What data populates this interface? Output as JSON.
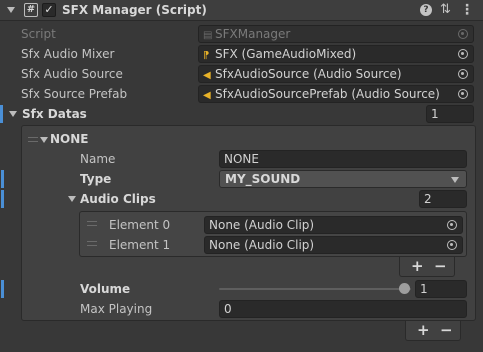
{
  "header": {
    "title": "SFX Manager (Script)",
    "enabled": true,
    "icons": [
      "hash-script-icon",
      "checkbox-icon",
      "help-icon",
      "settings-icon",
      "more-icon"
    ]
  },
  "fields": {
    "script": {
      "label": "Script",
      "value": "SFXManager"
    },
    "mixer": {
      "label": "Sfx Audio Mixer",
      "value": "SFX (GameAudioMixed)"
    },
    "source": {
      "label": "Sfx Audio Source",
      "value": "SfxAudioSource (Audio Source)"
    },
    "prefab": {
      "label": "Sfx Source Prefab",
      "value": "SfxAudioSourcePrefab (Audio Source)"
    }
  },
  "sfx_datas": {
    "label": "Sfx Datas",
    "size": "1",
    "element": {
      "title": "NONE",
      "name": {
        "label": "Name",
        "value": "NONE"
      },
      "type": {
        "label": "Type",
        "value": "MY_SOUND"
      },
      "audio_clips": {
        "label": "Audio Clips",
        "size": "2",
        "items": [
          {
            "label": "Element 0",
            "value": "None (Audio Clip)"
          },
          {
            "label": "Element 1",
            "value": "None (Audio Clip)"
          }
        ]
      },
      "volume": {
        "label": "Volume",
        "value": "1",
        "fraction": 1.0
      },
      "max_playing": {
        "label": "Max Playing",
        "value": "0"
      }
    }
  },
  "controls": {
    "plus": "+",
    "minus": "−"
  },
  "colors": {
    "accent": "#4a8fd6",
    "background": "#383838",
    "field": "#2a2a2a",
    "folder_icon": "#e8b228"
  }
}
